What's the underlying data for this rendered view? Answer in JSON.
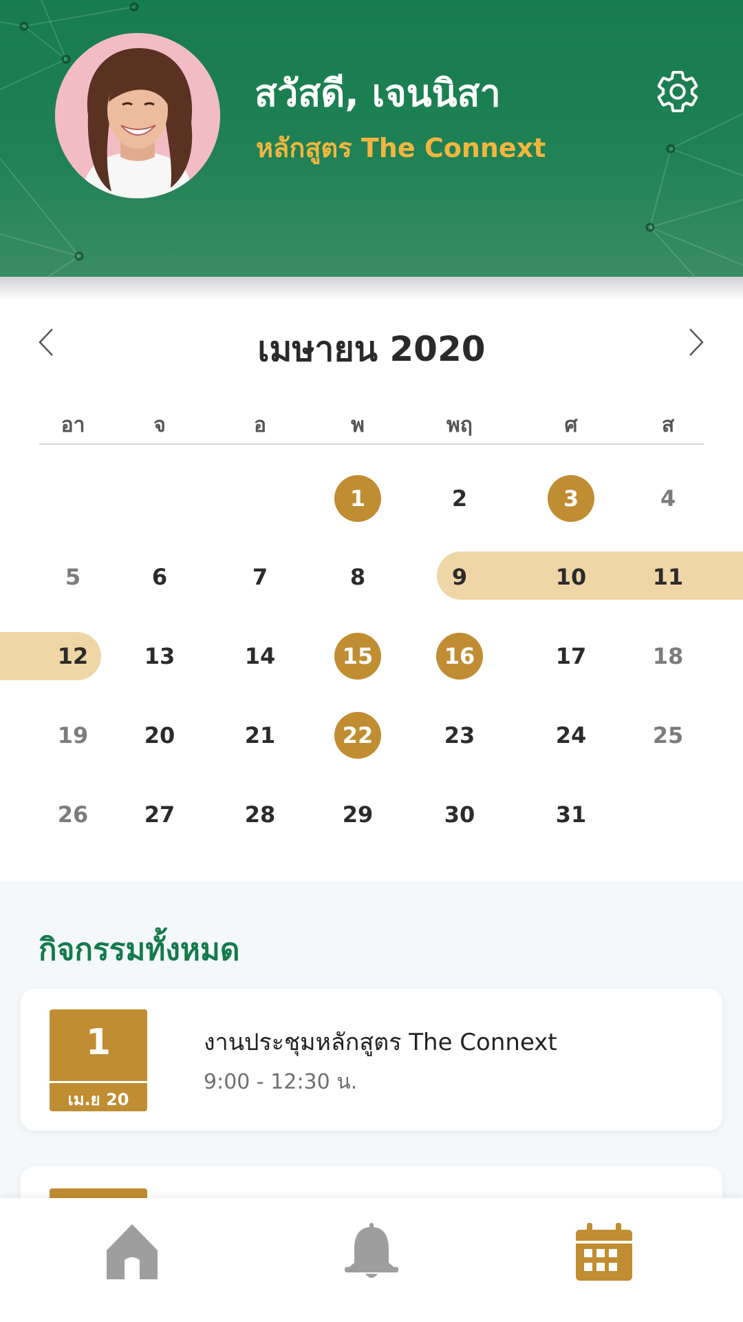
{
  "header": {
    "greeting": "สวัสดี, เจนนิสา",
    "course": "หลักสูตร The Connext"
  },
  "icons": {
    "settings": "gear-icon",
    "prev": "chevron-left-icon",
    "next": "chevron-right-icon",
    "home": "home-icon",
    "notifications": "bell-icon",
    "calendar": "calendar-icon"
  },
  "colors": {
    "header_green": "#177c4f",
    "gold_accent": "#c08d32",
    "range_highlight": "#efd6a6",
    "course_text": "#f2b63f",
    "section_title": "#157a4c",
    "inactive_nav": "#9e9e9e"
  },
  "calendar": {
    "month_title": "เมษายน 2020",
    "weekdays": [
      "อา",
      "จ",
      "อ",
      "พ",
      "พฤ",
      "ศ",
      "ส"
    ],
    "weeks": [
      [
        "",
        "",
        "",
        "1",
        "2",
        "3",
        "4"
      ],
      [
        "5",
        "6",
        "7",
        "8",
        "9",
        "10",
        "11"
      ],
      [
        "12",
        "13",
        "14",
        "15",
        "16",
        "17",
        "18"
      ],
      [
        "19",
        "20",
        "21",
        "22",
        "23",
        "24",
        "25"
      ],
      [
        "26",
        "27",
        "28",
        "29",
        "30",
        "31",
        ""
      ]
    ],
    "event_days": [
      "1",
      "3",
      "15",
      "16",
      "22"
    ],
    "highlighted_range": [
      "9",
      "10",
      "11",
      "12"
    ]
  },
  "activities": {
    "title": "กิจกรรมทั้งหมด",
    "items": [
      {
        "day": "1",
        "month": "เม.ย 20",
        "title": "งานประชุมหลักสูตร The Connext",
        "time": "9:00 - 12:30 น."
      }
    ]
  },
  "bottom_nav": {
    "active": "calendar"
  }
}
